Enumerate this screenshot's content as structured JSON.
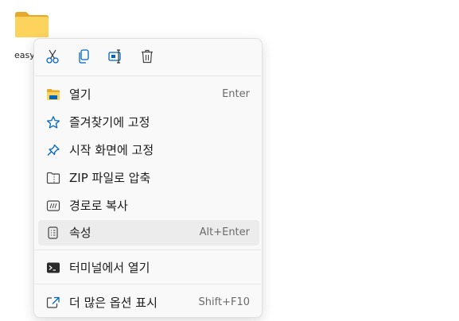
{
  "desktop": {
    "icon_label": "easy"
  },
  "toolbar": {
    "cut_icon": "cut-icon",
    "copy_icon": "copy-icon",
    "rename_icon": "rename-icon",
    "delete_icon": "delete-icon"
  },
  "menu": {
    "items": [
      {
        "label": "열기",
        "shortcut": "Enter",
        "icon": "folder-open-icon"
      },
      {
        "label": "즐겨찾기에 고정",
        "shortcut": "",
        "icon": "star-icon"
      },
      {
        "label": "시작 화면에 고정",
        "shortcut": "",
        "icon": "pin-icon"
      },
      {
        "label": "ZIP 파일로 압축",
        "shortcut": "",
        "icon": "zip-folder-icon"
      },
      {
        "label": "경로로 복사",
        "shortcut": "",
        "icon": "copy-path-icon"
      },
      {
        "label": "속성",
        "shortcut": "Alt+Enter",
        "icon": "properties-icon"
      },
      {
        "label": "터미널에서 열기",
        "shortcut": "",
        "icon": "terminal-icon"
      },
      {
        "label": "더 많은 옵션 표시",
        "shortcut": "Shift+F10",
        "icon": "more-options-icon"
      }
    ]
  },
  "colors": {
    "accent": "#0067c0",
    "menu_bg": "#f9f9f9",
    "hover_bg": "#ececec",
    "folder_yellow": "#f8c93e"
  }
}
